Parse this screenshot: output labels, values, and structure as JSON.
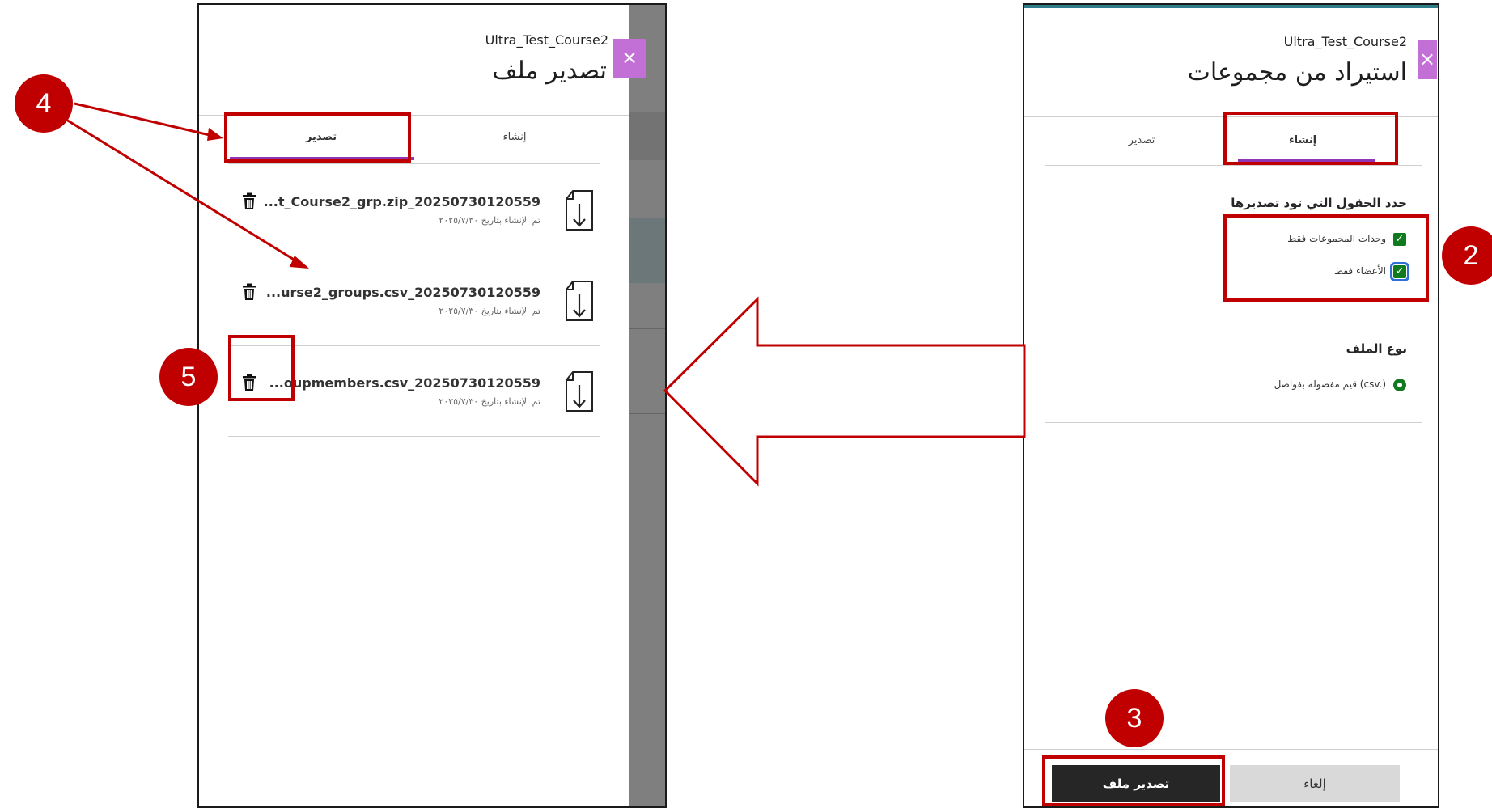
{
  "left_panel": {
    "course_name": "Ultra_Test_Course2",
    "title": "تصدير ملف",
    "close_symbol": "×",
    "tabs": [
      {
        "label": "تصدير",
        "active": true
      },
      {
        "label": "إنشاء",
        "active": false
      }
    ],
    "files": [
      {
        "name": "...t_Course2_grp.zip_20250730120559",
        "date": "تم الإنشاء بتاريخ ٢٠٢٥/٧/٣٠"
      },
      {
        "name": "...urse2_groups.csv_20250730120559",
        "date": "تم الإنشاء بتاريخ ٢٠٢٥/٧/٣٠"
      },
      {
        "name": "...oupmembers.csv_20250730120559",
        "date": "تم الإنشاء بتاريخ ٢٠٢٥/٧/٣٠"
      }
    ]
  },
  "right_panel": {
    "course_name": "Ultra_Test_Course2",
    "title": "استيراد من مجموعات",
    "tabs": [
      {
        "label": "إنشاء",
        "active": true
      },
      {
        "label": "تصدير",
        "active": false
      }
    ],
    "fields_heading": "حدد الحقول التي تود تصديرها",
    "options": [
      {
        "label": "وحدات المجموعات فقط",
        "checked": true
      },
      {
        "label": "الأعضاء فقط",
        "checked": true
      }
    ],
    "file_type_heading": "نوع الملف",
    "file_type_option": "قيم مفصولة بفواصل (csv.)",
    "buttons": {
      "cancel": "إلغاء",
      "export": "تصدير ملف"
    }
  },
  "annotations": {
    "badges": [
      "2",
      "3",
      "4",
      "5"
    ],
    "color": "#c00000"
  },
  "colors": {
    "accent_purple": "#8e36b6",
    "close_button": "#c26fd6",
    "check_green": "#0f7a1e"
  }
}
